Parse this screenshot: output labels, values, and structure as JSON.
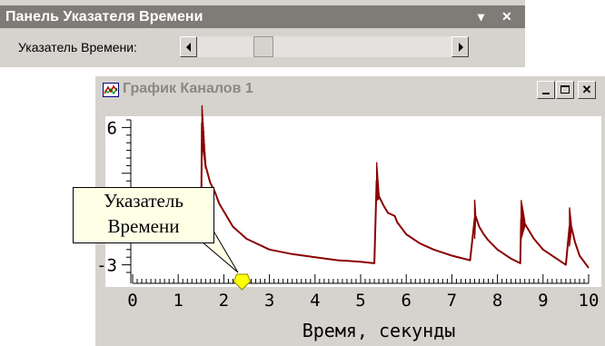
{
  "panel": {
    "title": "Панель Указателя Времени",
    "dropdown_glyph": "▾",
    "close_glyph": "✕",
    "label": "Указатель Времени:"
  },
  "graph_window": {
    "title": "График Каналов 1",
    "icon": "chart-app-icon",
    "minimize_glyph": "_",
    "maximize_glyph": "□",
    "close_glyph": "✕"
  },
  "callout": {
    "line1": "Указатель",
    "line2": "Времени"
  },
  "colors": {
    "signal": "#8b0000",
    "marker": "#ffff00",
    "plot_background": "#ffffff",
    "chrome": "#d6d3ce",
    "panel_title_bg": "#7f7c78"
  },
  "chart_data": {
    "type": "line",
    "title": "",
    "xlabel": "Время, секунды",
    "ylabel": "",
    "xlim": [
      0,
      10
    ],
    "ylim": [
      -3.5,
      6.5
    ],
    "x_ticks": [
      "0",
      "1",
      "2",
      "3",
      "4",
      "5",
      "6",
      "7",
      "8",
      "9",
      "10"
    ],
    "y_ticks": [
      "6",
      "-3"
    ],
    "time_pointer_x": 2.4,
    "series": [
      {
        "x": [
          0,
          0.3,
          0.6,
          0.9,
          1.2,
          1.45,
          1.5,
          1.52,
          1.6,
          1.7,
          1.8,
          1.9,
          2.0,
          2.2,
          2.5,
          3.0,
          3.5,
          4.0,
          4.5,
          5.0,
          5.3,
          5.35,
          5.4,
          5.5,
          5.6,
          5.75,
          5.8,
          5.9,
          6.0,
          6.3,
          6.6,
          7.0,
          7.4,
          7.5,
          7.52,
          7.6,
          7.7,
          7.8,
          8.0,
          8.3,
          8.5,
          8.52,
          8.6,
          8.7,
          8.8,
          9.0,
          9.3,
          9.5,
          9.58,
          9.62,
          9.7,
          9.8,
          10.0
        ],
        "values": [
          -1.0,
          -0.5,
          0.1,
          0.3,
          -1.0,
          -0.5,
          -1.2,
          6.3,
          3.5,
          2.4,
          1.8,
          1.0,
          0.5,
          -0.5,
          -1.3,
          -2.0,
          -2.3,
          -2.5,
          -2.7,
          -2.8,
          -2.9,
          2.5,
          1.5,
          0.9,
          0.4,
          0.2,
          -0.2,
          -0.6,
          -1.0,
          -1.6,
          -2.0,
          -2.4,
          -2.7,
          0.0,
          0.2,
          -0.5,
          -1.0,
          -1.4,
          -2.0,
          -2.6,
          -2.9,
          0.0,
          -0.3,
          -0.8,
          -1.3,
          -2.0,
          -2.6,
          -3.0,
          -0.5,
          -0.5,
          -1.5,
          -2.4,
          -3.2
        ]
      }
    ]
  }
}
